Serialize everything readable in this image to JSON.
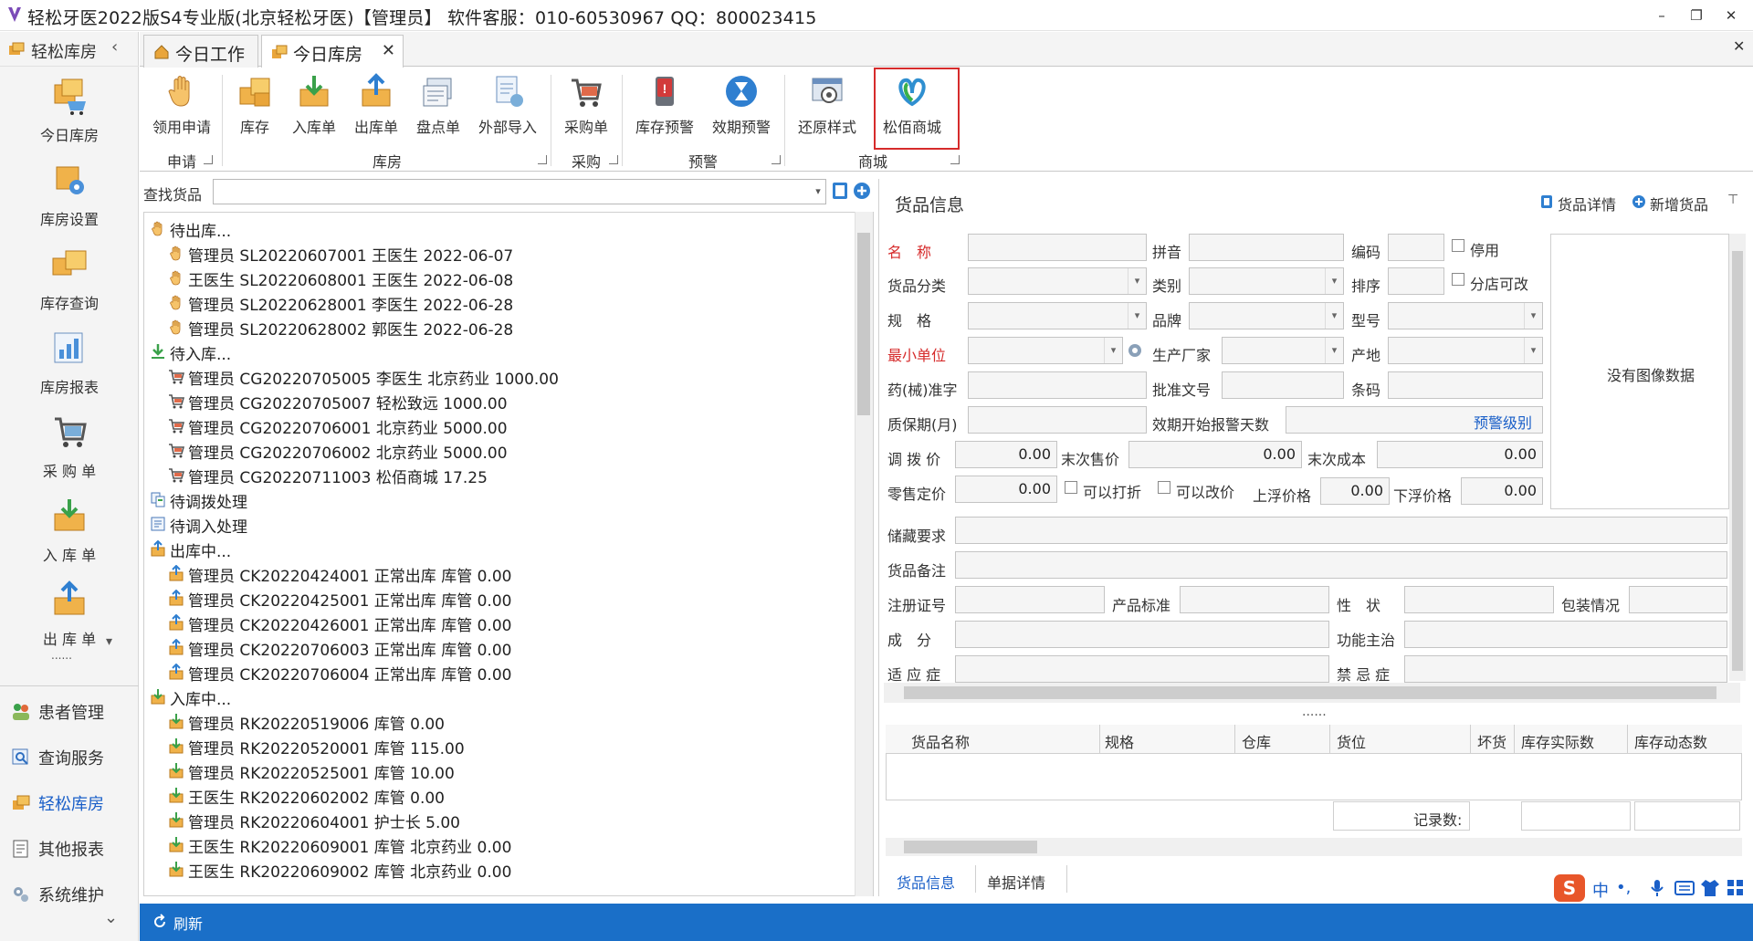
{
  "window": {
    "title": "轻松牙医2022版S4专业版(北京轻松牙医)【管理员】   软件客服：010-60530967 QQ：800023415",
    "minimize": "–",
    "restore": "❐",
    "close": "✕"
  },
  "nav": {
    "header_label": "轻松库房",
    "collapse": "‹",
    "big_items": [
      {
        "label": "今日库房",
        "icon": "warehouse-cart-icon"
      },
      {
        "label": "库房设置",
        "icon": "warehouse-settings-icon"
      },
      {
        "label": "库存查询",
        "icon": "inventory-boxes-icon"
      },
      {
        "label": "库房报表",
        "icon": "report-chart-icon"
      },
      {
        "label": "采 购 单",
        "icon": "shopping-cart-icon"
      },
      {
        "label": "入 库 单",
        "icon": "inbox-in-icon"
      },
      {
        "label": "出 库 单",
        "icon": "inbox-out-icon"
      }
    ],
    "more_arrow": "▾",
    "dots": "......",
    "small_items": [
      {
        "label": "患者管理",
        "icon": "patients-icon"
      },
      {
        "label": "查询服务",
        "icon": "query-icon"
      },
      {
        "label": "轻松库房",
        "icon": "warehouse-icon"
      },
      {
        "label": "其他报表",
        "icon": "reports-icon"
      },
      {
        "label": "系统维护",
        "icon": "system-gear-icon"
      }
    ],
    "bottom_arrow": "⌄"
  },
  "tabs": [
    {
      "label": "今日工作",
      "active": false
    },
    {
      "label": "今日库房",
      "active": true,
      "close": "✕"
    }
  ],
  "tabs_close_all": "✕",
  "ribbon": {
    "buttons": [
      {
        "label": "领用申请",
        "icon": "hand-icon"
      },
      {
        "label": "库存",
        "icon": "boxes-icon"
      },
      {
        "label": "入库单",
        "icon": "inbox-in-icon"
      },
      {
        "label": "出库单",
        "icon": "inbox-out-icon"
      },
      {
        "label": "盘点单",
        "icon": "stocktake-icon"
      },
      {
        "label": "外部导入",
        "icon": "import-icon"
      },
      {
        "label": "采购单",
        "icon": "shopping-cart-icon"
      },
      {
        "label": "库存预警",
        "icon": "alert-icon"
      },
      {
        "label": "效期预警",
        "icon": "hourglass-icon"
      },
      {
        "label": "还原样式",
        "icon": "restore-layout-icon"
      },
      {
        "label": "松佰商城",
        "icon": "mall-logo-icon"
      }
    ],
    "groups": [
      "申请",
      "库房",
      "采购",
      "预警",
      "商城"
    ]
  },
  "search": {
    "label": "查找货品",
    "value": "",
    "dropdown": "▾"
  },
  "tree": [
    {
      "level": 0,
      "icon": "hand-icon",
      "text": "待出库..."
    },
    {
      "level": 1,
      "icon": "hand-icon",
      "text": "管理员 SL20220607001 王医生 2022-06-07"
    },
    {
      "level": 1,
      "icon": "hand-icon",
      "text": "王医生 SL20220608001 王医生 2022-06-08"
    },
    {
      "level": 1,
      "icon": "hand-icon",
      "text": "管理员 SL20220628001 李医生 2022-06-28"
    },
    {
      "level": 1,
      "icon": "hand-icon",
      "text": "管理员 SL20220628002 郭医生 2022-06-28"
    },
    {
      "level": 0,
      "icon": "down-arrow-green-icon",
      "text": "待入库..."
    },
    {
      "level": 1,
      "icon": "cart-icon",
      "text": "管理员 CG20220705005 李医生 北京药业 1000.00"
    },
    {
      "level": 1,
      "icon": "cart-icon",
      "text": "管理员 CG20220705007  轻松致远 1000.00"
    },
    {
      "level": 1,
      "icon": "cart-icon",
      "text": "管理员 CG20220706001  北京药业 5000.00"
    },
    {
      "level": 1,
      "icon": "cart-icon",
      "text": "管理员 CG20220706002  北京药业 5000.00"
    },
    {
      "level": 1,
      "icon": "cart-icon",
      "text": "管理员 CG20220711003  松佰商城 17.25"
    },
    {
      "level": 0,
      "icon": "transfer-icon",
      "text": "待调拨处理"
    },
    {
      "level": 0,
      "icon": "transfer-in-icon",
      "text": "待调入处理"
    },
    {
      "level": 0,
      "icon": "inbox-out-icon",
      "text": "出库中..."
    },
    {
      "level": 1,
      "icon": "inbox-out-icon",
      "text": "管理员 CK20220424001 正常出库 库管    0.00"
    },
    {
      "level": 1,
      "icon": "inbox-out-icon",
      "text": "管理员 CK20220425001 正常出库 库管    0.00"
    },
    {
      "level": 1,
      "icon": "inbox-out-icon",
      "text": "管理员 CK20220426001 正常出库 库管    0.00"
    },
    {
      "level": 1,
      "icon": "inbox-out-icon",
      "text": "管理员 CK20220706003 正常出库 库管    0.00"
    },
    {
      "level": 1,
      "icon": "inbox-out-icon",
      "text": "管理员 CK20220706004 正常出库 库管    0.00"
    },
    {
      "level": 0,
      "icon": "inbox-in-icon",
      "text": "入库中..."
    },
    {
      "level": 1,
      "icon": "inbox-in-icon",
      "text": "管理员 RK20220519006 库管  0.00"
    },
    {
      "level": 1,
      "icon": "inbox-in-icon",
      "text": "管理员 RK20220520001 库管  115.00"
    },
    {
      "level": 1,
      "icon": "inbox-in-icon",
      "text": "管理员 RK20220525001 库管  10.00"
    },
    {
      "level": 1,
      "icon": "inbox-in-icon",
      "text": "王医生 RK20220602002 库管  0.00"
    },
    {
      "level": 1,
      "icon": "inbox-in-icon",
      "text": "管理员 RK20220604001 护士长  5.00"
    },
    {
      "level": 1,
      "icon": "inbox-in-icon",
      "text": "王医生 RK20220609001 库管 北京药业 0.00"
    },
    {
      "level": 1,
      "icon": "inbox-in-icon",
      "text": "王医生 RK20220609002 库管 北京药业 0.00"
    }
  ],
  "goods": {
    "title": "货品信息",
    "detail_link": "货品详情",
    "new_link": "新增货品",
    "pin": "⊤",
    "labels": {
      "name": "名　称",
      "pinyin": "拼音",
      "code": "编码",
      "disabled": "停用",
      "category": "货品分类",
      "type": "类别",
      "sort": "排序",
      "branch_edit": "分店可改",
      "spec": "规　格",
      "brand": "品牌",
      "model": "型号",
      "min_unit": "最小单位",
      "manufacturer": "生产厂家",
      "origin": "产地",
      "approval": "药(械)准字",
      "approval_no": "批准文号",
      "barcode": "条码",
      "shelf_life": "质保期(月)",
      "expiry_alert_days": "效期开始报警天数",
      "warn_level": "预警级别",
      "transfer_price": "调 拨 价",
      "last_price": "末次售价",
      "last_cost": "末次成本",
      "retail_price": "零售定价",
      "discountable": "可以打折",
      "price_editable": "可以改价",
      "float_up": "上浮价格",
      "float_down": "下浮价格",
      "storage": "储藏要求",
      "remark": "货品备注",
      "reg_no": "注册证号",
      "standard": "产品标准",
      "property": "性　状",
      "packing": "包装情况",
      "ingredients": "成　分",
      "function": "功能主治",
      "indications": "适 应 症",
      "contraindications": "禁 忌 症"
    },
    "values": {
      "transfer_price": "0.00",
      "last_price": "0.00",
      "last_cost": "0.00",
      "retail_price": "0.00",
      "float_up": "0.00",
      "float_down": "0.00"
    },
    "no_image": "没有图像数据",
    "dots": "......"
  },
  "grid": {
    "columns": [
      "货品名称",
      "规格",
      "仓库",
      "货位",
      "坏货",
      "库存实际数",
      "库存动态数"
    ],
    "record_label": "记录数:"
  },
  "bottom_tabs": [
    "货品信息",
    "单据详情"
  ],
  "ime": {
    "logo": "S",
    "lang": "中",
    "punct": "•,"
  },
  "statusbar": {
    "refresh": "刷新"
  },
  "colors": {
    "accent": "#1a6fc8",
    "highlight": "#d62b2b",
    "label_red": "#d62b2b"
  }
}
